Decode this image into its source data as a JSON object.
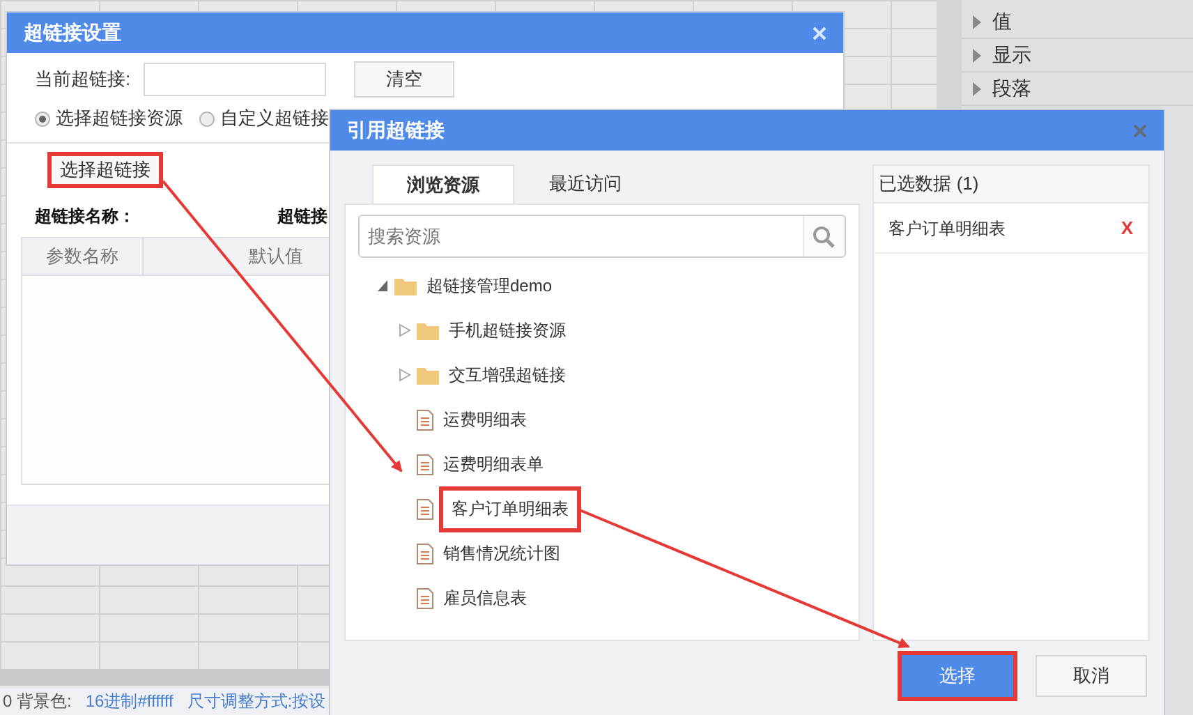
{
  "side_panel": {
    "items": [
      {
        "label": "值",
        "expanded": false
      },
      {
        "label": "显示",
        "expanded": false
      },
      {
        "label": "段落",
        "expanded": false
      }
    ]
  },
  "status_bar": {
    "texts": [
      "0 背景色:",
      "16进制#ffffff",
      "尺寸调整方式:按设"
    ]
  },
  "hyperlink_dialog": {
    "title": "超链接设置",
    "current_label": "当前超链接:",
    "clear_button": "清空",
    "radios": [
      {
        "label": "选择超链接资源",
        "selected": true
      },
      {
        "label": "自定义超链接",
        "selected": false
      }
    ],
    "select_button": "选择超链接",
    "name_label": "超链接名称：",
    "link_label": "超链接",
    "columns": [
      "参数名称",
      "默认值"
    ]
  },
  "reference_dialog": {
    "title": "引用超链接",
    "tabs": [
      {
        "label": "浏览资源",
        "selected": true
      },
      {
        "label": "最近访问",
        "selected": false
      }
    ],
    "search": {
      "placeholder": "搜索资源"
    },
    "tree": [
      {
        "kind": "folder",
        "label": "超链接管理demo",
        "expanded": true,
        "highlighted": false,
        "children": [
          {
            "kind": "folder",
            "label": "手机超链接资源",
            "expanded": false,
            "highlighted": false
          },
          {
            "kind": "folder",
            "label": "交互增强超链接",
            "expanded": false,
            "highlighted": false
          },
          {
            "kind": "report",
            "label": "运费明细表",
            "highlighted": false
          },
          {
            "kind": "report",
            "label": "运费明细表单",
            "highlighted": false
          },
          {
            "kind": "report",
            "label": "客户订单明细表",
            "highlighted": true
          },
          {
            "kind": "report",
            "label": "销售情况统计图",
            "highlighted": false
          },
          {
            "kind": "report",
            "label": "雇员信息表",
            "highlighted": false
          }
        ]
      }
    ],
    "selected_header": "已选数据 (1)",
    "selected_items": [
      {
        "label": "客户订单明细表",
        "remove": "X"
      }
    ],
    "buttons": [
      {
        "label": "选择",
        "primary": true,
        "highlighted": true
      },
      {
        "label": "取消",
        "primary": false,
        "highlighted": false
      }
    ]
  }
}
